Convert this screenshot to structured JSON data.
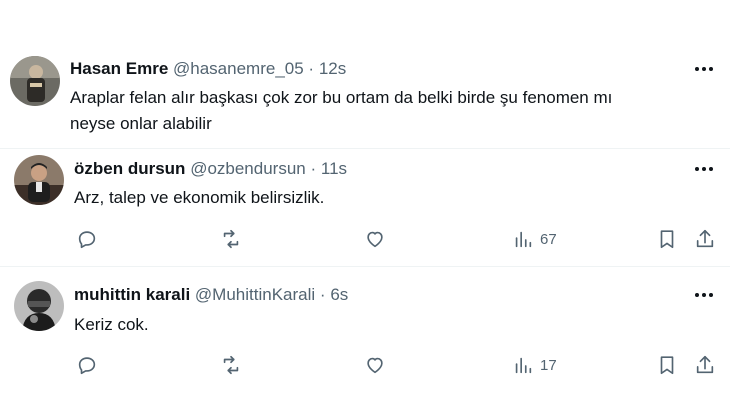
{
  "posts": [
    {
      "name": "Hasan Emre",
      "handle": "@hasanemre_05",
      "dot": "·",
      "time": "12s",
      "text_line1": "Araplar felan alır başkası çok zor bu ortam da belki birde şu fenomen mı",
      "text_line2": "neyse onlar alabilir"
    },
    {
      "name": "özben dursun",
      "handle": "@ozbendursun",
      "dot": "·",
      "time": "11s",
      "text": "Arz, talep ve ekonomik belirsizlik.",
      "views": "67"
    },
    {
      "name": "muhittin karali",
      "handle": "@MuhittinKarali",
      "dot": "·",
      "time": "6s",
      "text": "Keriz cok.",
      "views": "17"
    }
  ],
  "icons": {
    "reply": "reply-icon",
    "repost": "repost-icon",
    "like": "heart-icon",
    "views": "views-icon",
    "bookmark": "bookmark-icon",
    "share": "share-icon",
    "more": "more-icon"
  },
  "colors": {
    "text": "#0f1419",
    "secondary": "#536471",
    "divider": "#eff3f4"
  }
}
